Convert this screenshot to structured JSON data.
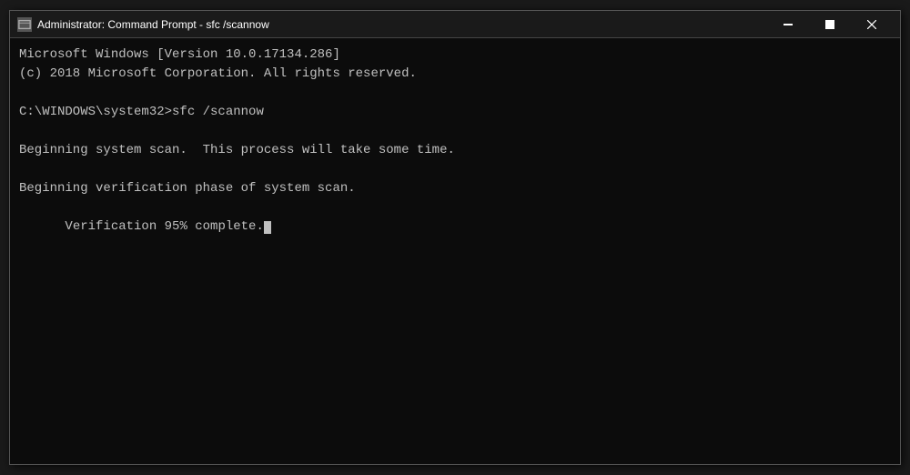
{
  "window": {
    "title": "Administrator: Command Prompt - sfc /scannow",
    "min_label": "minimize",
    "max_label": "maximize",
    "close_label": "close"
  },
  "console": {
    "lines": [
      "Microsoft Windows [Version 10.0.17134.286]",
      "(c) 2018 Microsoft Corporation. All rights reserved.",
      "",
      "C:\\WINDOWS\\system32>sfc /scannow",
      "",
      "Beginning system scan.  This process will take some time.",
      "",
      "Beginning verification phase of system scan.",
      "Verification 95% complete."
    ]
  }
}
